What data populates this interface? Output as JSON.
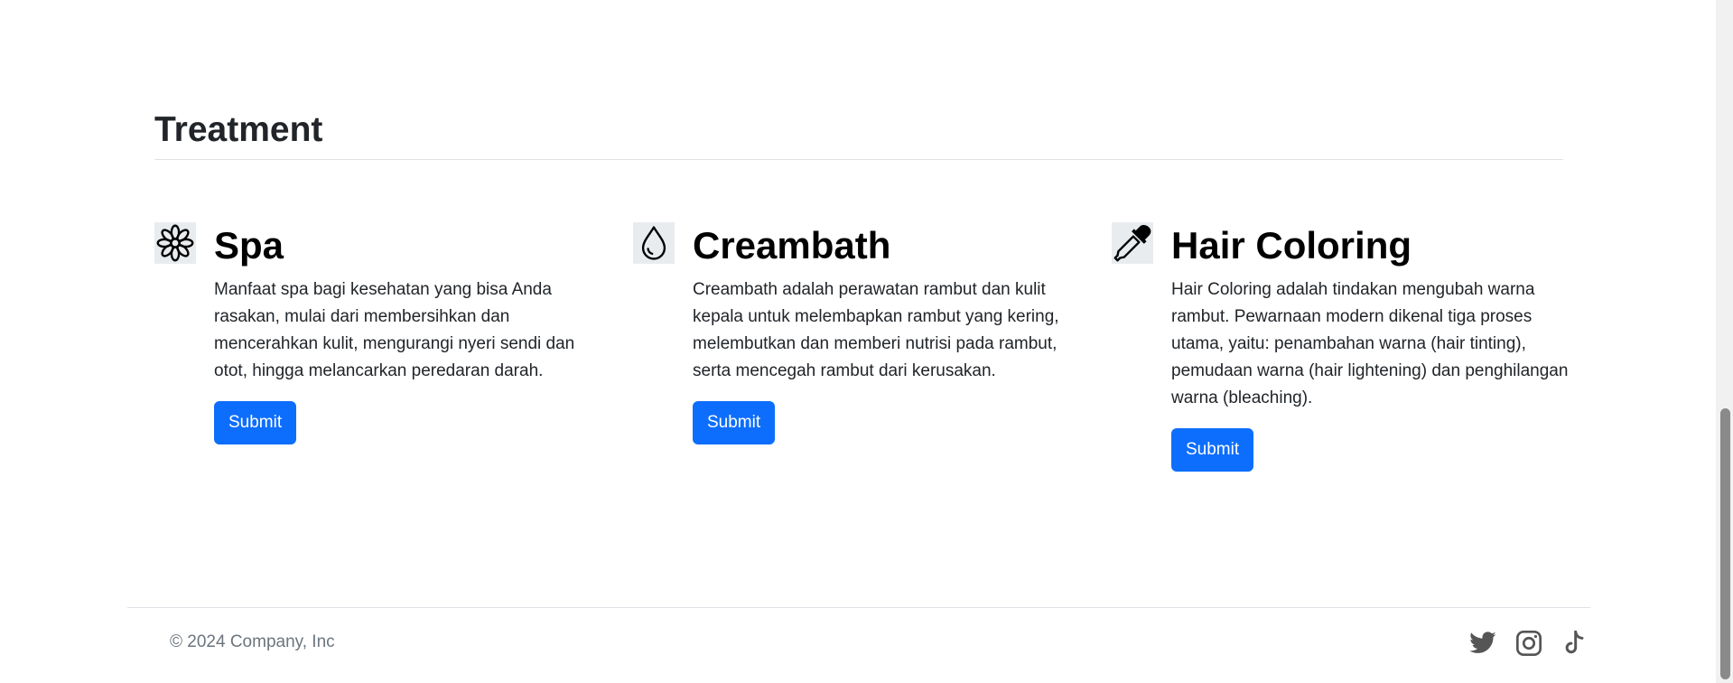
{
  "section": {
    "title": "Treatment"
  },
  "treatments": [
    {
      "icon": "flower-icon",
      "title": "Spa",
      "text": "Manfaat spa bagi kesehatan yang bisa Anda rasakan, mulai dari membersihkan dan mencerahkan kulit, mengurangi nyeri sendi dan otot, hingga melancarkan peredaran darah.",
      "button_label": "Submit"
    },
    {
      "icon": "droplet-icon",
      "title": "Creambath",
      "text": "Creambath adalah perawatan rambut dan kulit kepala untuk melembapkan rambut yang kering, melembutkan dan memberi nutrisi pada rambut, serta mencegah rambut dari kerusakan.",
      "button_label": "Submit"
    },
    {
      "icon": "eyedropper-icon",
      "title": "Hair Coloring",
      "text": "Hair Coloring adalah tindakan mengubah warna rambut. Pewarnaan modern dikenal tiga proses utama, yaitu: penambahan warna (hair tinting), pemudaan warna (hair lightening) dan penghilangan warna (bleaching).",
      "button_label": "Submit"
    }
  ],
  "footer": {
    "copyright": "© 2024 Company, Inc",
    "social": [
      "twitter-icon",
      "instagram-icon",
      "tiktok-icon"
    ]
  },
  "colors": {
    "primary": "#0d6efd",
    "muted": "#6c757d",
    "icon_bg": "#e9ecef"
  }
}
